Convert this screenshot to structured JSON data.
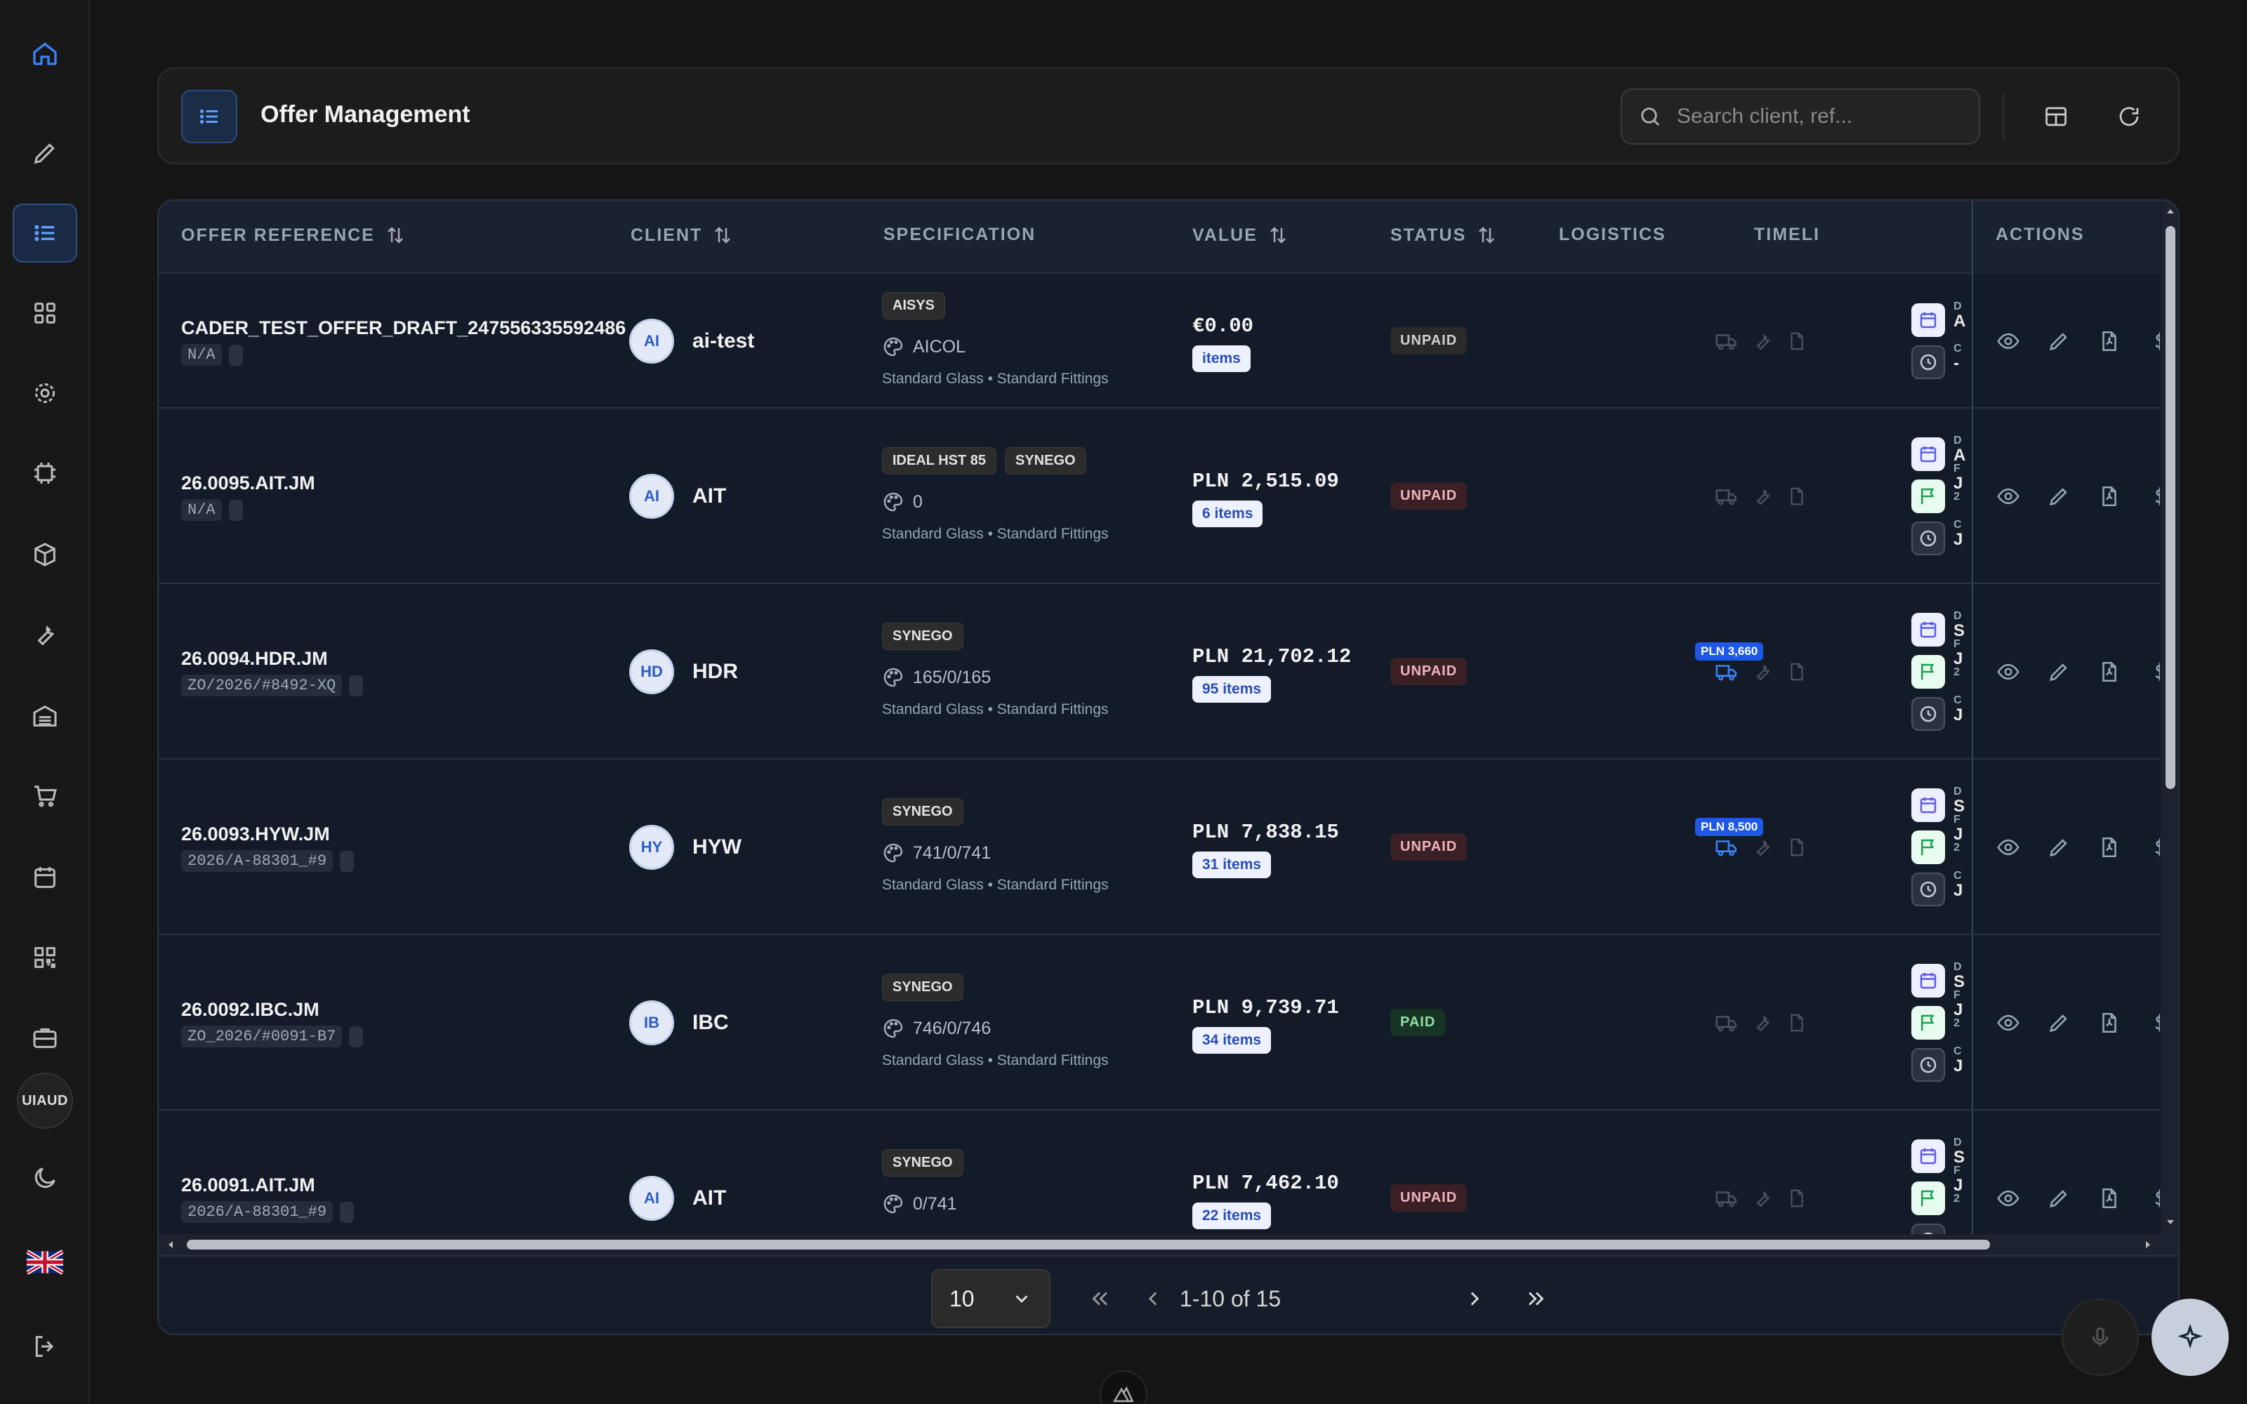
{
  "header": {
    "title": "Offer Management",
    "search_placeholder": "Search client, ref..."
  },
  "sidebar": {
    "items": [
      "home-icon",
      "pencil-icon",
      "list-icon",
      "grid-icon",
      "gear-icon",
      "chip-icon",
      "box-icon",
      "wrench-icon",
      "warehouse-icon",
      "cart-icon",
      "calendar-icon",
      "qr-icon",
      "briefcase-icon"
    ],
    "org_label": "UIAUD",
    "active": "list-icon"
  },
  "table": {
    "columns": {
      "offer_reference": "OFFER REFERENCE",
      "client": "CLIENT",
      "specification": "SPECIFICATION",
      "value": "VALUE",
      "status": "STATUS",
      "logistics": "LOGISTICS",
      "timeline": "TIMELI",
      "actions": "ACTIONS"
    },
    "rows": [
      {
        "ref": "CADER_TEST_OFFER_DRAFT_247556335592486",
        "subref": "N/A",
        "initials": "AI",
        "client": "ai-test",
        "tags": [
          "AISYS"
        ],
        "color": "AICOL",
        "spec": "Standard Glass • Standard Fittings",
        "value": "€0.00",
        "items": "items",
        "status": "UNPAID",
        "shipping": "",
        "tl": [
          [
            "D",
            "A"
          ],
          [
            "C",
            "-"
          ]
        ]
      },
      {
        "ref": "26.0095.AIT.JM",
        "subref": "N/A",
        "initials": "AI",
        "client": "AIT",
        "tags": [
          "IDEAL HST 85",
          "SYNEGO"
        ],
        "color": "0",
        "spec": "Standard Glass • Standard Fittings",
        "value": "PLN 2,515.09",
        "items": "6 items",
        "status": "UNPAID",
        "shipping": "",
        "tl": [
          [
            "D",
            "A"
          ],
          [
            "F",
            "J"
          ],
          [
            "2",
            ""
          ],
          [
            "C",
            "J"
          ]
        ]
      },
      {
        "ref": "26.0094.HDR.JM",
        "subref": "ZO/2026/#8492-XQ",
        "initials": "HD",
        "client": "HDR",
        "tags": [
          "SYNEGO"
        ],
        "color": "165/0/165",
        "spec": "Standard Glass • Standard Fittings",
        "value": "PLN 21,702.12",
        "items": "95 items",
        "status": "UNPAID",
        "shipping": "PLN 3,660",
        "tl": [
          [
            "D",
            "S"
          ],
          [
            "F",
            "J"
          ],
          [
            "2",
            ""
          ],
          [
            "C",
            "J"
          ]
        ]
      },
      {
        "ref": "26.0093.HYW.JM",
        "subref": "2026/A-88301_#9",
        "initials": "HY",
        "client": "HYW",
        "tags": [
          "SYNEGO"
        ],
        "color": "741/0/741",
        "spec": "Standard Glass • Standard Fittings",
        "value": "PLN 7,838.15",
        "items": "31 items",
        "status": "UNPAID",
        "shipping": "PLN 8,500",
        "tl": [
          [
            "D",
            "S"
          ],
          [
            "F",
            "J"
          ],
          [
            "2",
            ""
          ],
          [
            "C",
            "J"
          ]
        ]
      },
      {
        "ref": "26.0092.IBC.JM",
        "subref": "ZO_2026/#0091-B7",
        "initials": "IB",
        "client": "IBC",
        "tags": [
          "SYNEGO"
        ],
        "color": "746/0/746",
        "spec": "Standard Glass • Standard Fittings",
        "value": "PLN 9,739.71",
        "items": "34 items",
        "status": "PAID",
        "shipping": "",
        "tl": [
          [
            "D",
            "S"
          ],
          [
            "F",
            "J"
          ],
          [
            "2",
            ""
          ],
          [
            "C",
            "J"
          ]
        ]
      },
      {
        "ref": "26.0091.AIT.JM",
        "subref": "2026/A-88301_#9",
        "initials": "AI",
        "client": "AIT",
        "tags": [
          "SYNEGO"
        ],
        "color": "0/741",
        "spec": "",
        "value": "PLN 7,462.10",
        "items": "22 items",
        "status": "UNPAID",
        "shipping": "",
        "tl": [
          [
            "D",
            "S"
          ],
          [
            "F",
            "J"
          ],
          [
            "2",
            ""
          ]
        ]
      }
    ]
  },
  "pagination": {
    "page_size": "10",
    "range": "1-10 of 15"
  },
  "colors": {
    "accent": "#2e6ff2",
    "unpaid": "#f0b4bd",
    "paid": "#8ee0a8"
  }
}
